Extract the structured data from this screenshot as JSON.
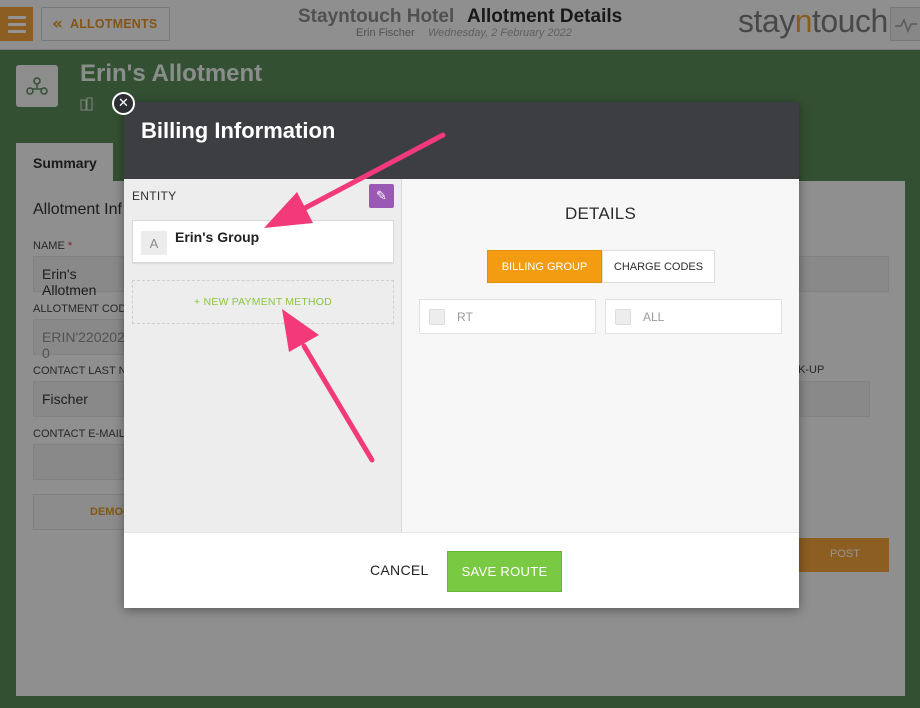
{
  "topbar": {
    "back_label": "ALLOTMENTS",
    "hotel_name": "Stayntouch Hotel",
    "page_title": "Allotment Details",
    "user_name": "Erin Fischer",
    "date": "Wednesday, 2 February 2022",
    "logo_left": "stay",
    "logo_mid": "n",
    "logo_right": "touch"
  },
  "background": {
    "allotment_title": "Erin's Allotment",
    "tab_summary": "Summary",
    "section_title": "Allotment Inf",
    "name_label": "NAME",
    "name_value": "Erin's Allotmen",
    "code_label": "ALLOTMENT CODE",
    "code_value": "ERIN'220202-0",
    "contact_last_label": "CONTACT LAST NA",
    "contact_last_value": "Fischer",
    "contact_email_label": "CONTACT E-MAIL",
    "demo_button": "DEMOG",
    "pickup_label": "K-UP",
    "post_button": "POST"
  },
  "modal": {
    "title": "Billing Information",
    "entity_label": "ENTITY",
    "entity_letter": "A",
    "entity_name": "Erin's Group",
    "new_payment": "+ NEW PAYMENT METHOD",
    "details_title": "DETAILS",
    "segments": {
      "billing_group": "BILLING GROUP",
      "charge_codes": "CHARGE CODES"
    },
    "checkbox_items": [
      "RT",
      "ALL"
    ],
    "cancel": "CANCEL",
    "save": "SAVE ROUTE"
  },
  "colors": {
    "accent_orange": "#f39c12",
    "save_green": "#7ac943",
    "edit_purple": "#9b59b6",
    "annotation_pink": "#f23a7a"
  }
}
